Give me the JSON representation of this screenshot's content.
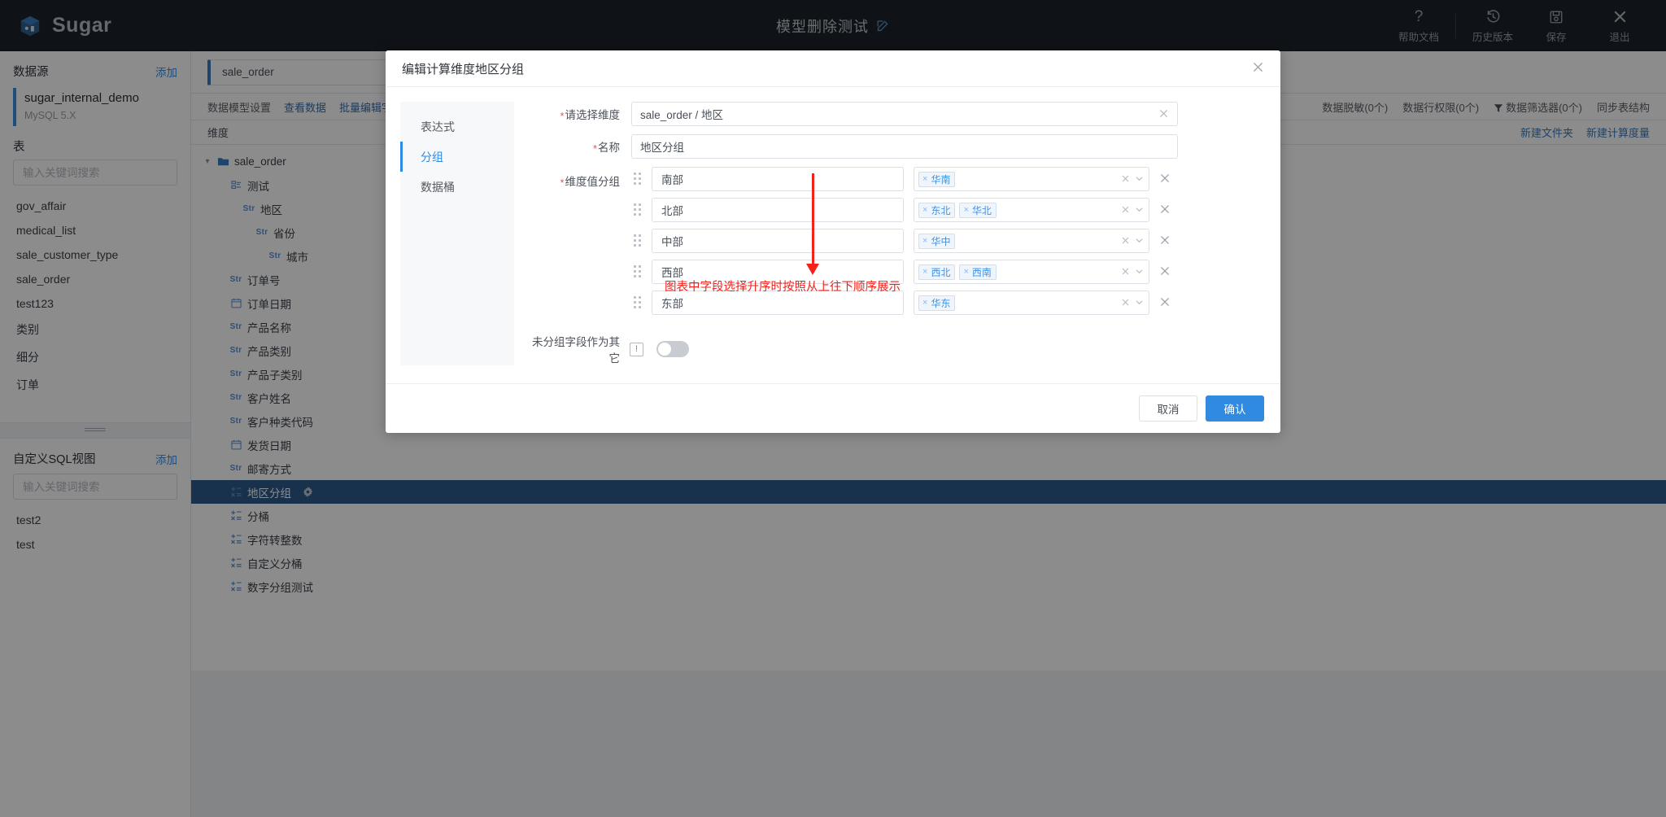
{
  "header": {
    "brand": "Sugar",
    "brand_logo_icon": "cube-logo-icon",
    "doc_title": "模型删除测试",
    "edit_icon": "edit-pencil-icon",
    "actions": [
      {
        "label": "帮助文档",
        "icon": "question-mark-icon",
        "glyph": "?"
      },
      {
        "label": "历史版本",
        "icon": "history-clock-icon",
        "glyph": "↺"
      },
      {
        "label": "保存",
        "icon": "save-disk-icon",
        "glyph": "▤"
      },
      {
        "label": "退出",
        "icon": "close-x-icon",
        "glyph": "✕"
      }
    ]
  },
  "sidebar": {
    "datasource_title": "数据源",
    "datasource_add": "添加",
    "datasource_name": "sugar_internal_demo",
    "datasource_type": "MySQL 5.X",
    "tables_title": "表",
    "tables_search_placeholder": "输入关键词搜索",
    "tables_search_value": "",
    "tables": [
      "gov_affair",
      "medical_list",
      "sale_customer_type",
      "sale_order",
      "test123",
      "类别",
      "细分",
      "订单"
    ],
    "sqlview_title": "自定义SQL视图",
    "sqlview_add": "添加",
    "sqlview_search_placeholder": "输入关键词搜索",
    "sqlview_search_value": "",
    "sqlviews": [
      "test2",
      "test"
    ]
  },
  "main": {
    "tab_label": "sale_order",
    "toolbar_left": [
      {
        "label": "数据模型设置",
        "style": "plain"
      },
      {
        "label": "查看数据",
        "style": "link"
      },
      {
        "label": "批量编辑字段",
        "style": "link"
      }
    ],
    "toolbar_right": [
      {
        "label": "数据脱敏(0个)",
        "icon": ""
      },
      {
        "label": "数据行权限(0个)",
        "icon": ""
      },
      {
        "label": "数据筛选器(0个)",
        "icon": "funnel-filter-icon"
      },
      {
        "label": "同步表结构",
        "icon": ""
      }
    ],
    "subbar_label": "维度",
    "subbar_links": [
      "新建文件夹",
      "新建计算度量"
    ],
    "tree": [
      {
        "label": "sale_order",
        "icon": "folder-icon",
        "indent": 0,
        "caret": "▾",
        "selected": false
      },
      {
        "label": "测试",
        "icon": "group-icon",
        "indent": 1,
        "caret": "",
        "selected": false
      },
      {
        "label": "地区",
        "icon": "str-icon",
        "indent": 2,
        "caret": "",
        "selected": false
      },
      {
        "label": "省份",
        "icon": "str-icon",
        "indent": 3,
        "caret": "",
        "selected": false
      },
      {
        "label": "城市",
        "icon": "str-icon",
        "indent": 4,
        "caret": "",
        "selected": false
      },
      {
        "label": "订单号",
        "icon": "str-icon",
        "indent": 1,
        "caret": "",
        "selected": false
      },
      {
        "label": "订单日期",
        "icon": "calendar-icon",
        "indent": 1,
        "caret": "",
        "selected": false
      },
      {
        "label": "产品名称",
        "icon": "str-icon",
        "indent": 1,
        "caret": "",
        "selected": false
      },
      {
        "label": "产品类别",
        "icon": "str-icon",
        "indent": 1,
        "caret": "",
        "selected": false
      },
      {
        "label": "产品子类别",
        "icon": "str-icon",
        "indent": 1,
        "caret": "",
        "selected": false
      },
      {
        "label": "客户姓名",
        "icon": "str-icon",
        "indent": 1,
        "caret": "",
        "selected": false
      },
      {
        "label": "客户种类代码",
        "icon": "str-icon",
        "indent": 1,
        "caret": "",
        "selected": false
      },
      {
        "label": "发货日期",
        "icon": "calendar-icon",
        "indent": 1,
        "caret": "",
        "selected": false
      },
      {
        "label": "邮寄方式",
        "icon": "str-icon",
        "indent": 1,
        "caret": "",
        "selected": false
      },
      {
        "label": "地区分组",
        "icon": "calc-field-icon",
        "indent": 1,
        "caret": "",
        "selected": true,
        "gear": "gear-icon"
      },
      {
        "label": "分桶",
        "icon": "calc-field-icon",
        "indent": 1,
        "caret": "",
        "selected": false
      },
      {
        "label": "字符转整数",
        "icon": "calc-field-icon",
        "indent": 1,
        "caret": "",
        "selected": false
      },
      {
        "label": "自定义分桶",
        "icon": "calc-field-icon",
        "indent": 1,
        "caret": "",
        "selected": false
      },
      {
        "label": "数字分组测试",
        "icon": "calc-field-icon",
        "indent": 1,
        "caret": "",
        "selected": false
      }
    ]
  },
  "dialog": {
    "title": "编辑计算维度地区分组",
    "close_icon": "close-x-icon",
    "tabs": [
      {
        "label": "表达式",
        "active": false
      },
      {
        "label": "分组",
        "active": true
      },
      {
        "label": "数据桶",
        "active": false
      }
    ],
    "fields": {
      "dimension_label": "请选择维度",
      "dimension_value": "sale_order / 地区",
      "name_label": "名称",
      "name_value": "地区分组",
      "groups_label": "维度值分组"
    },
    "groups": [
      {
        "name": "南部",
        "tags": [
          "华南"
        ]
      },
      {
        "name": "北部",
        "tags": [
          "东北",
          "华北"
        ]
      },
      {
        "name": "中部",
        "tags": [
          "华中"
        ]
      },
      {
        "name": "西部",
        "tags": [
          "西北",
          "西南"
        ]
      },
      {
        "name": "东部",
        "tags": [
          "华东"
        ]
      }
    ],
    "annotation": "图表中字段选择升序时按照从上往下顺序展示",
    "other_label": "未分组字段作为其它",
    "other_info_icon": "info-exclamation-icon",
    "other_toggle_on": false,
    "cancel_label": "取消",
    "confirm_label": "确认",
    "accent_color": "#2f8ae0",
    "annotation_color": "#f5221b"
  }
}
